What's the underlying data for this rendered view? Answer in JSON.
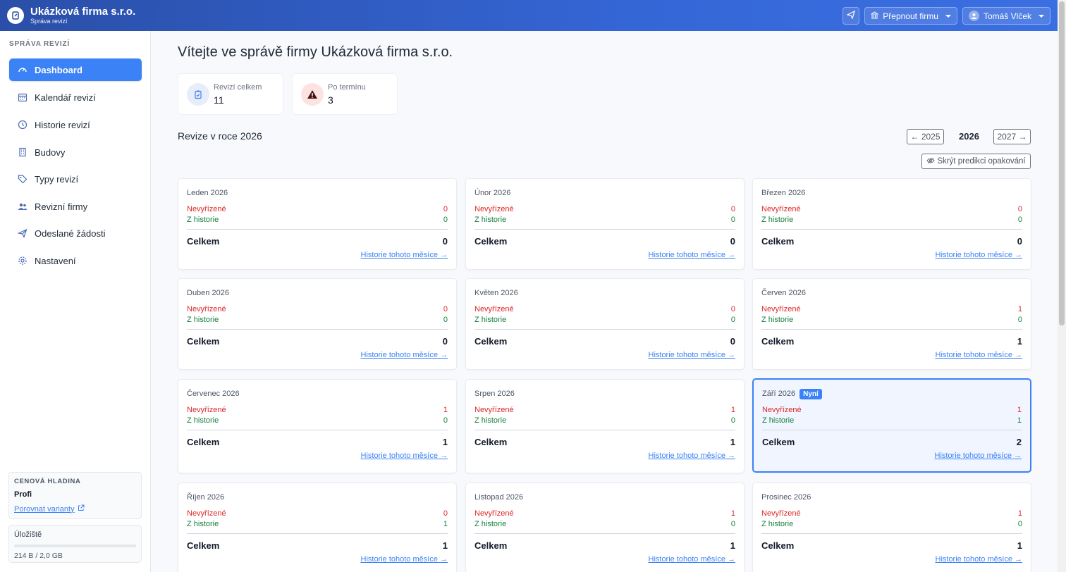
{
  "header": {
    "company": "Ukázková firma s.r.o.",
    "subtitle": "Správa revizí",
    "switch_company": "Přepnout firmu",
    "user": "Tomáš Vlček"
  },
  "sidebar": {
    "section_title": "SPRÁVA REVIZÍ",
    "items": [
      {
        "label": "Dashboard",
        "icon": "gauge-icon",
        "active": true
      },
      {
        "label": "Kalendář revizí",
        "icon": "calendar-icon"
      },
      {
        "label": "Historie revizí",
        "icon": "clock-icon"
      },
      {
        "label": "Budovy",
        "icon": "building-icon"
      },
      {
        "label": "Typy revizí",
        "icon": "tag-icon"
      },
      {
        "label": "Revizní firmy",
        "icon": "users-icon"
      },
      {
        "label": "Odeslané žádosti",
        "icon": "send-icon"
      },
      {
        "label": "Nastavení",
        "icon": "gear-icon"
      }
    ],
    "plan": {
      "title": "CENOVÁ HLADINA",
      "name": "Profi",
      "compare_link": "Porovnat varianty"
    },
    "storage": {
      "label": "Úložiště",
      "usage": "214 B / 2,0 GB",
      "fraction": 0.0
    }
  },
  "main": {
    "title": "Vítejte ve správě firmy Ukázková firma s.r.o.",
    "stats": [
      {
        "label": "Revizí celkem",
        "value": "11"
      },
      {
        "label": "Po termínu",
        "value": "3"
      }
    ],
    "year_heading": "Revize v roce 2026",
    "prev_year": "← 2025",
    "current_year": "2026",
    "next_year": "2027 →",
    "prediction_toggle": "Skrýt predikci opakování",
    "labels": {
      "pending": "Nevyřízené",
      "history": "Z historie",
      "total": "Celkem",
      "history_link": "Historie tohoto měsíce →",
      "now_badge": "Nyní"
    },
    "months": [
      {
        "name": "Leden 2026",
        "pending": "0",
        "history": "0",
        "total": "0"
      },
      {
        "name": "Únor 2026",
        "pending": "0",
        "history": "0",
        "total": "0"
      },
      {
        "name": "Březen 2026",
        "pending": "0",
        "history": "0",
        "total": "0"
      },
      {
        "name": "Duben 2026",
        "pending": "0",
        "history": "0",
        "total": "0"
      },
      {
        "name": "Květen 2026",
        "pending": "0",
        "history": "0",
        "total": "0"
      },
      {
        "name": "Červen 2026",
        "pending": "1",
        "history": "0",
        "total": "1"
      },
      {
        "name": "Červenec 2026",
        "pending": "1",
        "history": "0",
        "total": "1"
      },
      {
        "name": "Srpen 2026",
        "pending": "1",
        "history": "0",
        "total": "1"
      },
      {
        "name": "Září 2026",
        "pending": "1",
        "history": "1",
        "total": "2",
        "current": true
      },
      {
        "name": "Říjen 2026",
        "pending": "0",
        "history": "1",
        "total": "1"
      },
      {
        "name": "Listopad 2026",
        "pending": "1",
        "history": "0",
        "total": "1"
      },
      {
        "name": "Prosinec 2026",
        "pending": "1",
        "history": "0",
        "total": "1"
      }
    ]
  },
  "colors": {
    "accent": "#3b82f6",
    "pending": "#dc2626",
    "history": "#15803d",
    "header": "#3566d6"
  }
}
